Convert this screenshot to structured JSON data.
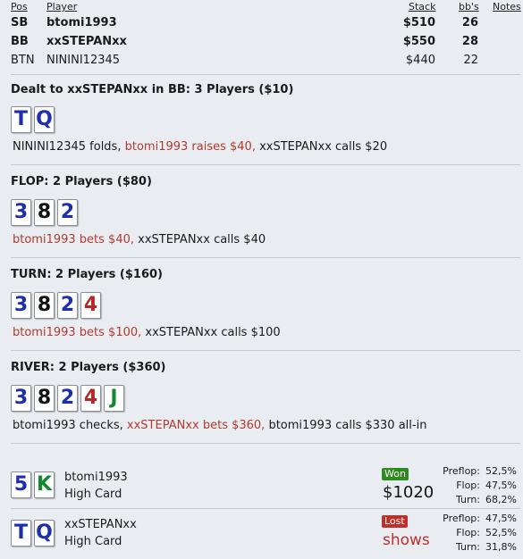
{
  "header": {
    "pos": "Pos",
    "player": "Player",
    "stack": "Stack",
    "bbs": "bb's",
    "notes": "Notes"
  },
  "players": [
    {
      "pos": "SB",
      "name": "btomi1993",
      "stack": "$510",
      "bbs": "26",
      "bold": true
    },
    {
      "pos": "BB",
      "name": "xxSTEPANxx",
      "stack": "$550",
      "bbs": "28",
      "bold": true
    },
    {
      "pos": "BTN",
      "name": "NININI12345",
      "stack": "$440",
      "bbs": "22",
      "bold": false
    }
  ],
  "preflop": {
    "title": "Dealt to xxSTEPANxx in BB: 3 Players ($10)",
    "actions": [
      "NININI12345 folds, ",
      "btomi1993 raises $40, ",
      "xxSTEPANxx calls $20"
    ]
  },
  "flop": {
    "title": "FLOP: 2 Players ($80)",
    "actions": [
      "btomi1993 bets $40, ",
      "xxSTEPANxx calls $40"
    ]
  },
  "turn": {
    "title": "TURN: 2 Players ($160)",
    "actions": [
      "btomi1993 bets $100, ",
      "xxSTEPANxx calls $100"
    ]
  },
  "river": {
    "title": "RIVER: 2 Players ($360)",
    "actions": [
      "btomi1993 checks, ",
      "xxSTEPANxx bets $360, ",
      "btomi1993 calls $330 all-in"
    ]
  },
  "cards": {
    "hole": [
      {
        "rank": "T",
        "suit": "blue"
      },
      {
        "rank": "Q",
        "suit": "blue"
      }
    ],
    "flop": [
      {
        "rank": "3",
        "suit": "blue"
      },
      {
        "rank": "8",
        "suit": "black"
      },
      {
        "rank": "2",
        "suit": "blue"
      }
    ],
    "turn": [
      {
        "rank": "3",
        "suit": "blue"
      },
      {
        "rank": "8",
        "suit": "black"
      },
      {
        "rank": "2",
        "suit": "blue"
      },
      {
        "rank": "4",
        "suit": "red"
      }
    ],
    "river": [
      {
        "rank": "3",
        "suit": "blue"
      },
      {
        "rank": "8",
        "suit": "black"
      },
      {
        "rank": "2",
        "suit": "blue"
      },
      {
        "rank": "4",
        "suit": "red"
      },
      {
        "rank": "J",
        "suit": "green"
      }
    ],
    "res1": [
      {
        "rank": "5",
        "suit": "blue"
      },
      {
        "rank": "K",
        "suit": "green"
      }
    ],
    "res2": [
      {
        "rank": "T",
        "suit": "blue"
      },
      {
        "rank": "Q",
        "suit": "blue"
      }
    ]
  },
  "results": [
    {
      "name": "btomi1993",
      "hand": "High Card",
      "badge": "Won",
      "badge_color": "#2f8a1f",
      "amount": "$1020",
      "amount_color": "#111111",
      "stats": [
        {
          "label": "Preflop:",
          "value": "52,5%"
        },
        {
          "label": "Flop:",
          "value": "47,5%"
        },
        {
          "label": "Turn:",
          "value": "68,2%"
        }
      ]
    },
    {
      "name": "xxSTEPANxx",
      "hand": "High Card",
      "badge": "Lost",
      "badge_color": "#c0302a",
      "amount": "shows",
      "amount_color": "#c0302a",
      "stats": [
        {
          "label": "Preflop:",
          "value": "47,5%"
        },
        {
          "label": "Flop:",
          "value": "52,5%"
        },
        {
          "label": "Turn:",
          "value": "31,8%"
        }
      ]
    }
  ]
}
